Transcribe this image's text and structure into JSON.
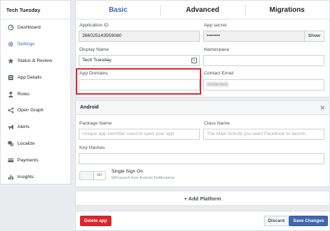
{
  "sidebar": {
    "app_name": "Tech Tuesday",
    "items": [
      {
        "label": "Dashboard",
        "icon": "dashboard-icon"
      },
      {
        "label": "Settings",
        "icon": "gear-icon",
        "active": true
      },
      {
        "label": "Status & Review",
        "icon": "star-icon"
      },
      {
        "label": "App Details",
        "icon": "app-details-icon"
      },
      {
        "label": "Roles",
        "icon": "person-icon"
      },
      {
        "label": "Open Graph",
        "icon": "open-graph-icon"
      },
      {
        "label": "Alerts",
        "icon": "megaphone-icon"
      },
      {
        "label": "Localize",
        "icon": "localize-icon"
      },
      {
        "label": "Payments",
        "icon": "card-icon"
      },
      {
        "label": "Insights",
        "icon": "chart-icon"
      }
    ]
  },
  "tabs": [
    "Basic",
    "Advanced",
    "Migrations"
  ],
  "basic": {
    "app_id_label": "Application ID",
    "app_id_value": "266025143559080",
    "app_secret_label": "App secret",
    "app_secret_value": "••••••••",
    "show_label": "Show",
    "display_name_label": "Display Name",
    "display_name_value": "Tech Tuesday",
    "namespace_label": "Namespace",
    "namespace_value": "",
    "app_domains_label": "App Domains",
    "app_domains_value": "",
    "contact_email_label": "Contact Email",
    "contact_email_value": "[redacted]"
  },
  "android": {
    "title": "Android",
    "package_label": "Package Name",
    "package_placeholder": "Unique app identifier used to open your app",
    "class_label": "Class Name",
    "class_placeholder": "The Main Activity you want Facebook to launch",
    "key_hashes_label": "Key Hashes",
    "toggle_state": "NO",
    "sso_title": "Single Sign On",
    "sso_sub": "Will launch from Android Notifications"
  },
  "add_platform_label": "+ Add Platform",
  "footer": {
    "delete_label": "Delete app",
    "discard_label": "Discard",
    "save_label": "Save Changes"
  },
  "colors": {
    "accent": "#4267b2",
    "danger": "#e0262b",
    "highlight": "#e0262b"
  }
}
